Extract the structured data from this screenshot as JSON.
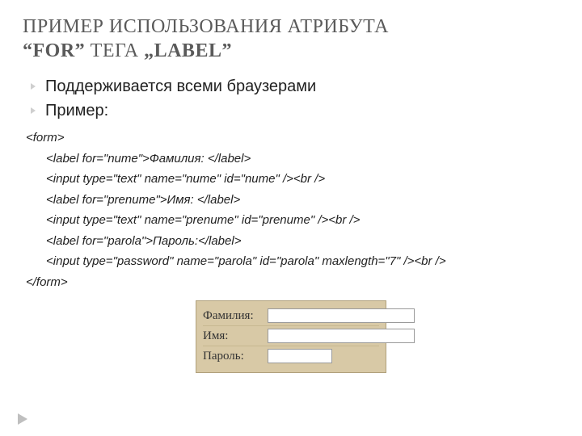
{
  "title": {
    "l1_a": "ПРИМЕР ИСПОЛЬЗОВАНИЯ АТРИБУТА",
    "l2_a": "“FOR”",
    "l2_b": " ТЕГА ",
    "l2_c": "„LABEL”"
  },
  "bullets": {
    "b1": "Поддерживается всеми браузерами",
    "b2": "Пример:"
  },
  "code": "<form>\n      <label for=\"nume\">Фамилия: </label>\n      <input type=\"text\" name=\"nume\" id=\"nume\" /><br />\n      <label for=\"prenume\">Имя: </label>\n      <input type=\"text\" name=\"prenume\" id=\"prenume\" /><br />\n      <label for=\"parola\">Пароль:</label>\n      <input type=\"password\" name=\"parola\" id=\"parola\" maxlength=\"7\" /><br />\n</form>",
  "form": {
    "lname_label": "Фамилия:",
    "fname_label": "Имя:",
    "pw_label": "Пароль:",
    "lname_value": "",
    "fname_value": "",
    "pw_value": ""
  }
}
